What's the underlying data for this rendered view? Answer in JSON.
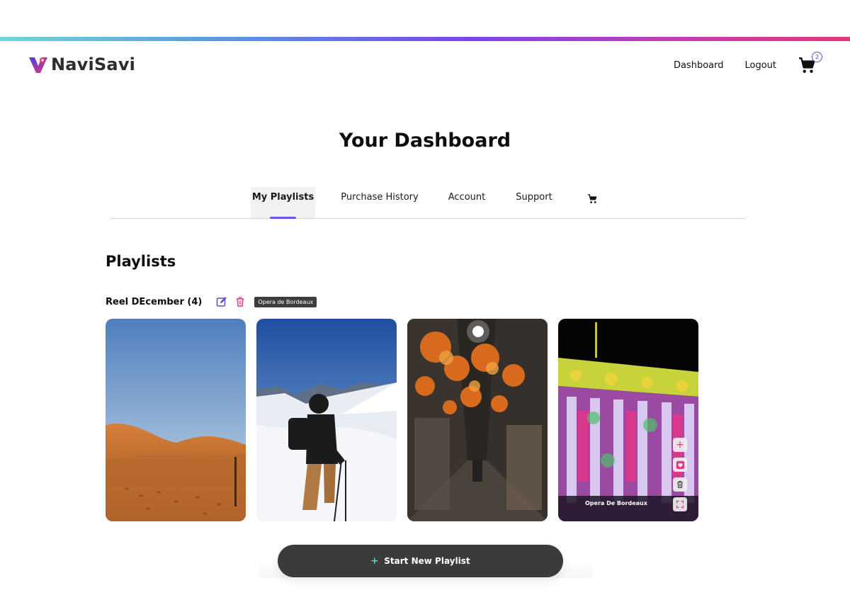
{
  "brand": {
    "name": "NaviSavi"
  },
  "nav": {
    "dashboard": "Dashboard",
    "logout": "Logout",
    "cart_count": "2"
  },
  "page": {
    "title": "Your Dashboard"
  },
  "tabs": [
    {
      "label": "My Playlists",
      "active": true
    },
    {
      "label": "Purchase History",
      "active": false
    },
    {
      "label": "Account",
      "active": false
    },
    {
      "label": "Support",
      "active": false
    }
  ],
  "section": {
    "title": "Playlists"
  },
  "playlist": {
    "name": "Reel DEcember (4)",
    "tooltip": "Opera de Bordeaux",
    "items": [
      {
        "scene": "desert-dunes"
      },
      {
        "scene": "skier-mountains"
      },
      {
        "scene": "autumn-alley"
      },
      {
        "scene": "illuminated-opera",
        "caption": "Opera De Bordeaux"
      }
    ]
  },
  "actions": {
    "start_new_playlist": "Start New Playlist"
  },
  "colors": {
    "accent": "#6a55e0",
    "pink": "#e8348a",
    "button": "#3b3b3b"
  }
}
